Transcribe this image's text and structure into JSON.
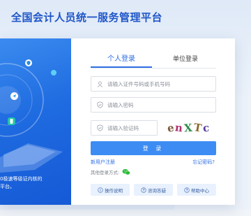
{
  "header": {
    "title": "全国会计人员统一服务管理平台"
  },
  "promo": {
    "text_line1": "0极速等级证内核的",
    "text_line2": "平台。"
  },
  "login": {
    "tabs": [
      {
        "label": "个人登录",
        "active": true
      },
      {
        "label": "单位登录",
        "active": false
      }
    ],
    "id_placeholder": "请输入证件号码或手机号码",
    "password_placeholder": "请输入密码",
    "captcha_placeholder": "请输入验证码",
    "captcha_text": [
      "e",
      "n",
      "X",
      "T",
      "c"
    ],
    "captcha_colors": [
      "#7a5a3a",
      "#b03070",
      "#2f8a4a",
      "#8a6a2a",
      "#5a3aa0"
    ],
    "submit_label": "登 录",
    "register_label": "新用户注册",
    "forgot_label": "忘记密码?",
    "other_methods_label": "其他登录方式:",
    "other_method_icon": "wechat-icon",
    "help_buttons": [
      {
        "label": "操作说明",
        "icon": "info-circle-icon"
      },
      {
        "label": "咨询答疑",
        "icon": "question-circle-icon"
      },
      {
        "label": "帮助中心",
        "icon": "help-circle-icon"
      }
    ]
  },
  "colors": {
    "brand_blue": "#1f56c9",
    "accent": "#2f6fe4",
    "button": "#3d8cf3",
    "promo_blue": "#1f6be0",
    "wechat_green": "#2dbd3a"
  }
}
